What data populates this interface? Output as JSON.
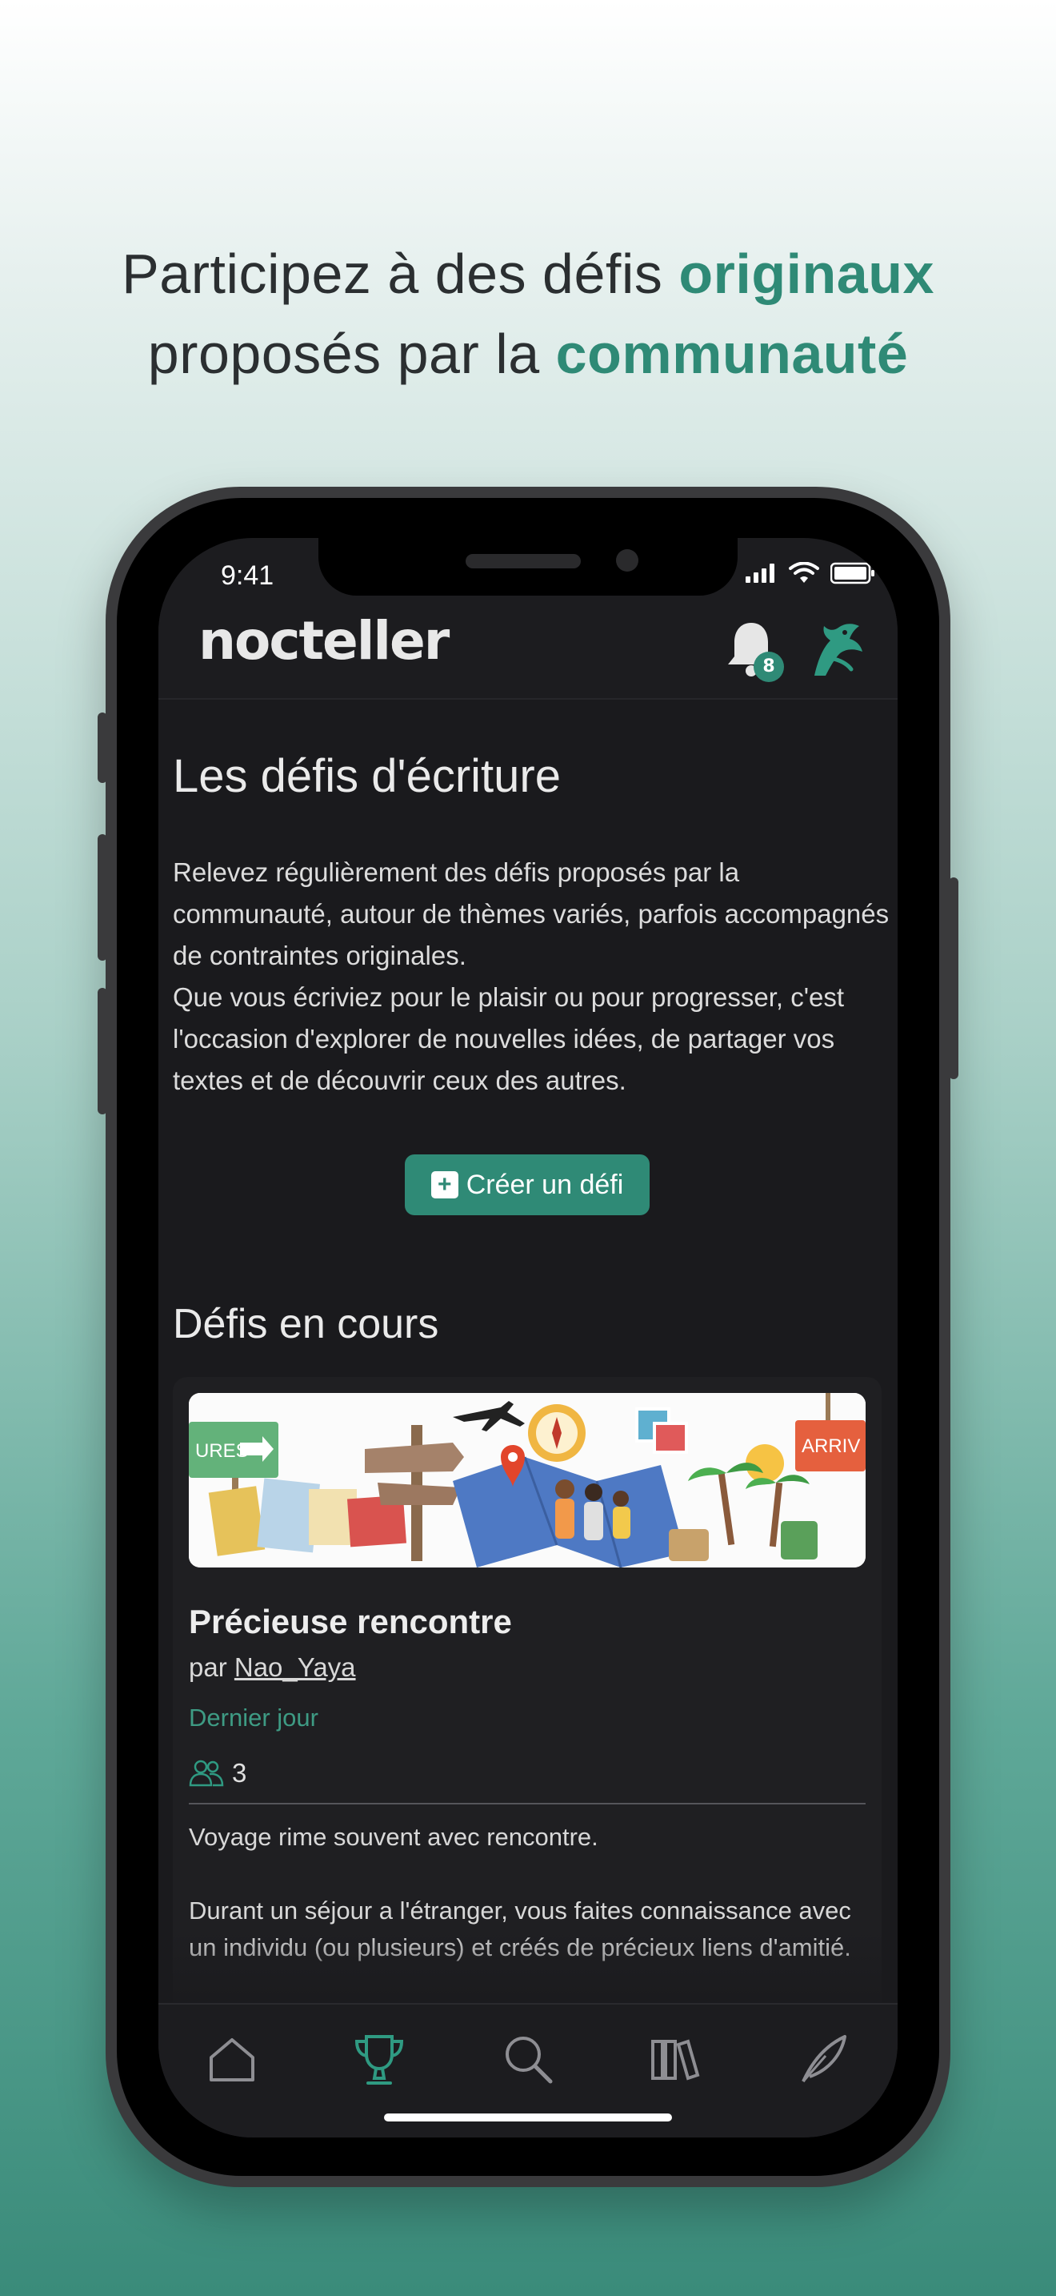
{
  "marketing": {
    "line1_prefix": "Participez à des défis ",
    "line1_highlight": "originaux",
    "line2_prefix": "proposés par la ",
    "line2_highlight": "communauté"
  },
  "status_bar": {
    "time": "9:41"
  },
  "header": {
    "logo": "nocteller",
    "notification_count": "8"
  },
  "page": {
    "title": "Les défis d'écriture",
    "intro_p1": "Relevez régulièrement des défis proposés par la communauté, autour de thèmes variés, parfois accompagnés de contraintes originales.",
    "intro_p2": "Que vous écriviez pour le plaisir ou pour progresser, c'est l'occasion d'explorer de nouvelles idées, de partager vos textes et de découvrir ceux des autres.",
    "create_button": "Créer un défi",
    "section_title": "Défis en cours"
  },
  "challenge": {
    "banner_left_sign": "URES",
    "banner_right_sign": "ARRIV",
    "title": "Précieuse rencontre",
    "author_prefix": "par ",
    "author": "Nao_Yaya",
    "deadline": "Dernier jour",
    "participants": "3",
    "desc_p1": "Voyage rime souvent avec rencontre.",
    "desc_p2": "Durant un séjour a l'étranger, vous faites connaissance avec un individu (ou plusieurs) et créés de précieux liens d'amitié."
  },
  "tabbar": {
    "items": [
      {
        "icon": "home-icon",
        "active": false
      },
      {
        "icon": "trophy-icon",
        "active": true
      },
      {
        "icon": "search-icon",
        "active": false
      },
      {
        "icon": "library-icon",
        "active": false
      },
      {
        "icon": "quill-icon",
        "active": false
      }
    ]
  },
  "colors": {
    "accent": "#2f8a76",
    "screen_bg": "#1c1c1f",
    "text": "#eaeaea"
  }
}
